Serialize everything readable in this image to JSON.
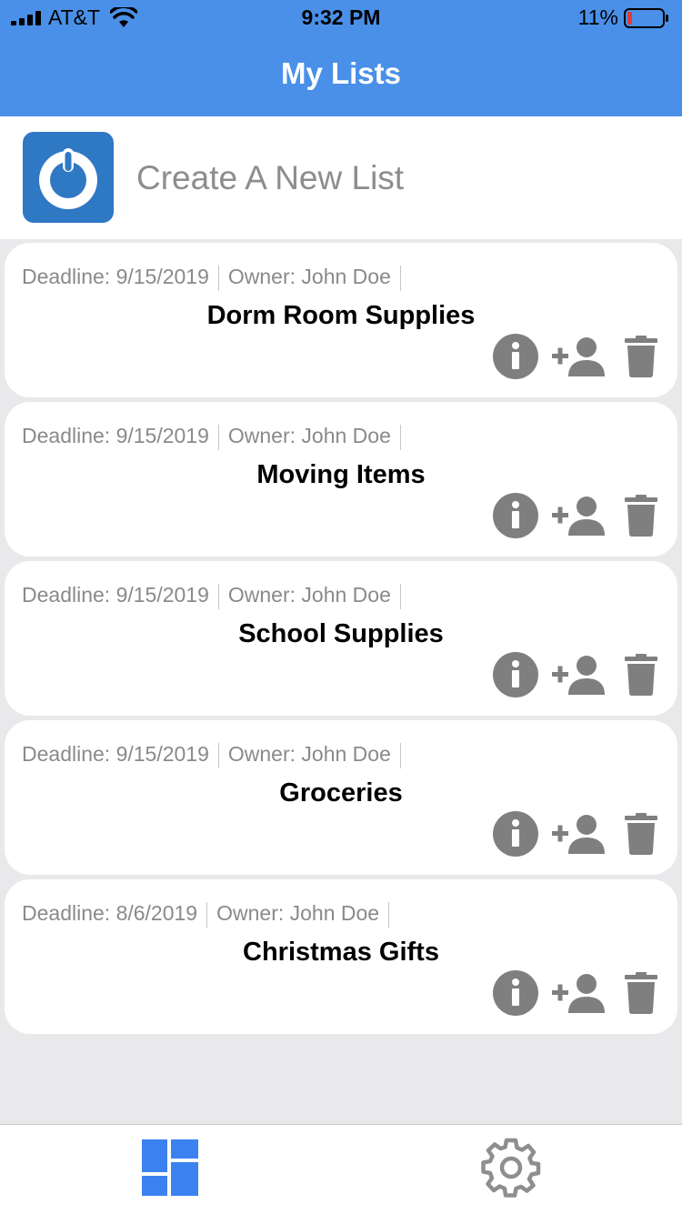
{
  "status_bar": {
    "carrier": "AT&T",
    "time": "9:32 PM",
    "battery_percent": "11%"
  },
  "nav": {
    "title": "My Lists"
  },
  "create": {
    "label": "Create A New List"
  },
  "lists": [
    {
      "deadline": "Deadline: 9/15/2019",
      "owner": "Owner: John Doe",
      "title": "Dorm Room Supplies"
    },
    {
      "deadline": "Deadline: 9/15/2019",
      "owner": "Owner: John Doe",
      "title": "Moving Items"
    },
    {
      "deadline": "Deadline: 9/15/2019",
      "owner": "Owner: John Doe",
      "title": "School Supplies"
    },
    {
      "deadline": "Deadline: 9/15/2019",
      "owner": "Owner: John Doe",
      "title": "Groceries"
    },
    {
      "deadline": "Deadline: 8/6/2019",
      "owner": "Owner: John Doe",
      "title": "Christmas Gifts"
    }
  ],
  "icons": {
    "info": "info-icon",
    "add_user": "add-user-icon",
    "delete": "trash-icon",
    "lists_tab": "dashboard-icon",
    "settings_tab": "gear-icon"
  },
  "colors": {
    "nav_background": "#4a90e8",
    "app_icon": "#2f78c4",
    "action_icons": "#7f7f7f",
    "active_tab": "#3b82f0",
    "inactive_tab": "#8e8e8e",
    "battery_low": "#e53935"
  }
}
